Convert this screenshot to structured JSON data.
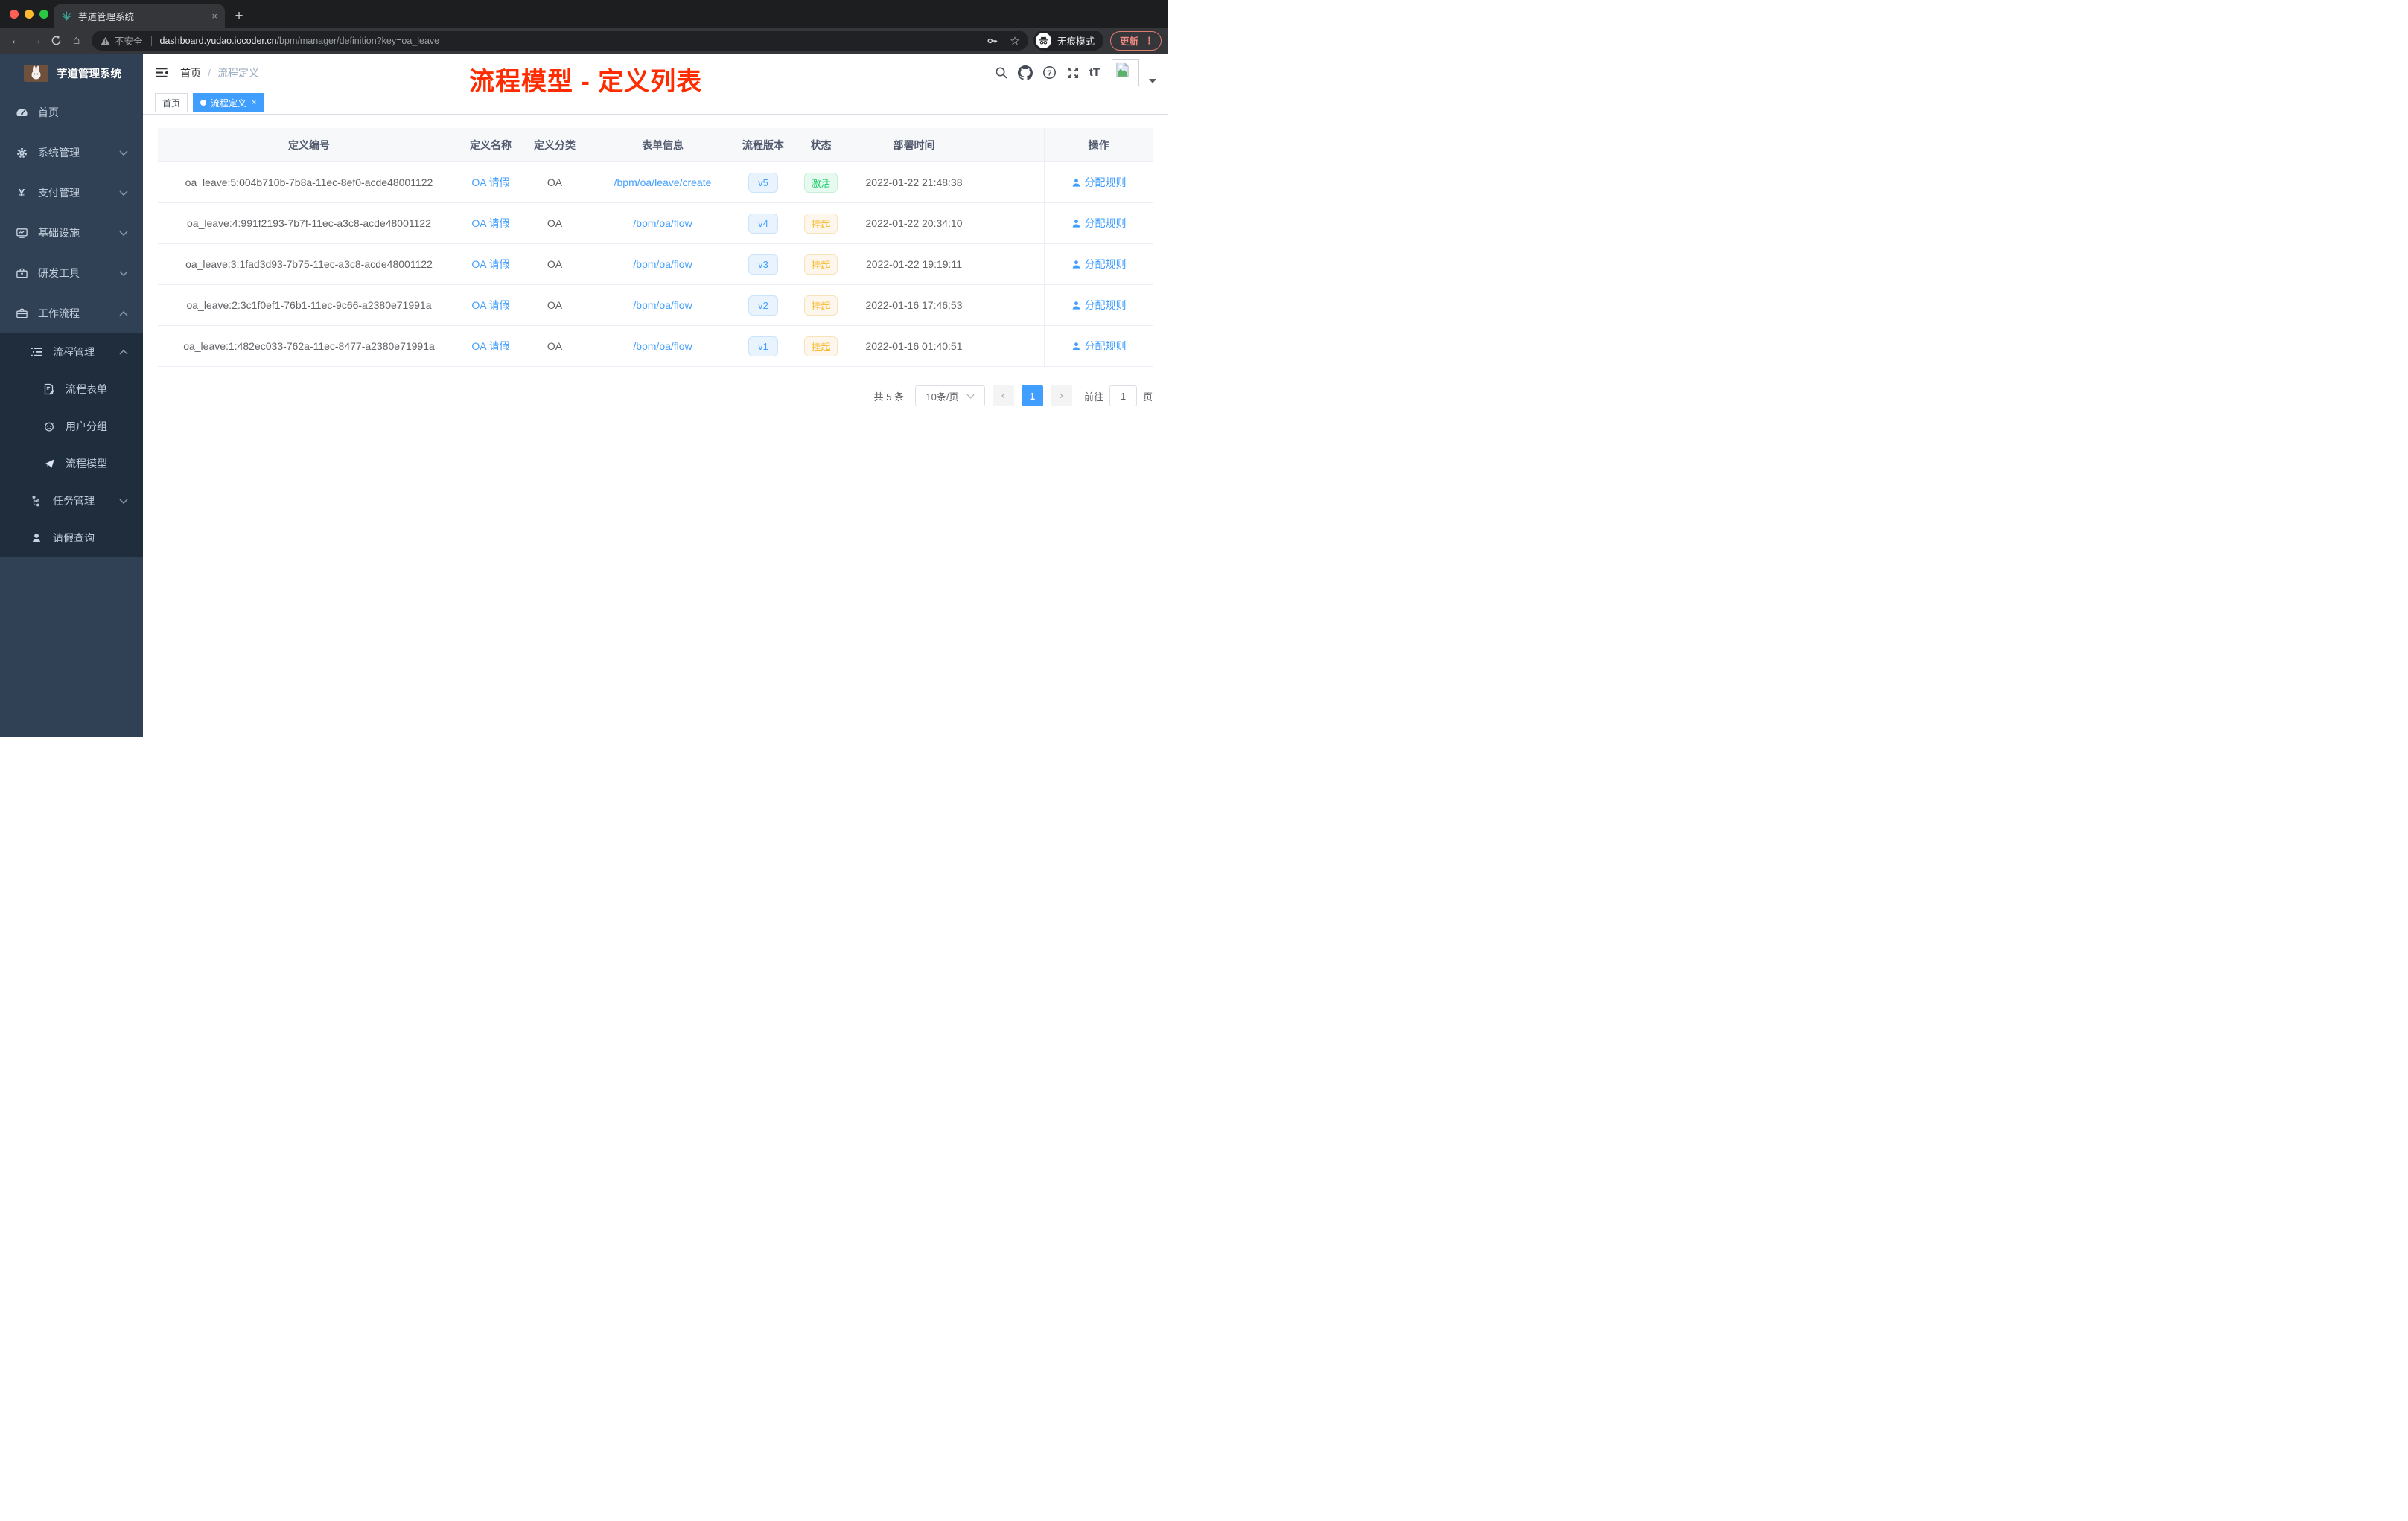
{
  "browser": {
    "tab": {
      "title": "芋道管理系统",
      "close_label": "×",
      "new_tab_label": "+"
    },
    "address": {
      "security_label": "不安全",
      "domain": "dashboard.yudao.iocoder.cn",
      "path": "/bpm/manager/definition?key=oa_leave"
    },
    "incognito_label": "无痕模式",
    "update_label": "更新",
    "menu_dots": "⋮"
  },
  "sidebar": {
    "logo_title": "芋道管理系统",
    "menu": [
      {
        "label": "首页"
      },
      {
        "label": "系统管理"
      },
      {
        "label": "支付管理"
      },
      {
        "label": "基础设施"
      },
      {
        "label": "研发工具"
      },
      {
        "label": "工作流程"
      }
    ],
    "workflow_submenu": {
      "parent": {
        "label": "流程管理"
      },
      "children": [
        {
          "label": "流程表单"
        },
        {
          "label": "用户分组"
        },
        {
          "label": "流程模型"
        }
      ],
      "siblings": [
        {
          "label": "任务管理"
        },
        {
          "label": "请假查询"
        }
      ]
    },
    "yen_glyph": "¥"
  },
  "header": {
    "breadcrumb": {
      "root": "首页",
      "separator": "/",
      "current": "流程定义"
    },
    "font_size_icon_label": "tT"
  },
  "annotation": {
    "text": "流程模型 - 定义列表",
    "color": "#fe2c00"
  },
  "tags": [
    {
      "label": "首页",
      "active": false
    },
    {
      "label": "流程定义",
      "active": true,
      "close_label": "×"
    }
  ],
  "table": {
    "columns": [
      "定义编号",
      "定义名称",
      "定义分类",
      "表单信息",
      "流程版本",
      "状态",
      "部署时间",
      "操作"
    ],
    "rows": [
      {
        "id": "oa_leave:5:004b710b-7b8a-11ec-8ef0-acde48001122",
        "name": "OA 请假",
        "category": "OA",
        "form": "/bpm/oa/leave/create",
        "version": "v5",
        "status": "激活",
        "deployed_at": "2022-01-22 21:48:38",
        "action": "分配规则"
      },
      {
        "id": "oa_leave:4:991f2193-7b7f-11ec-a3c8-acde48001122",
        "name": "OA 请假",
        "category": "OA",
        "form": "/bpm/oa/flow",
        "version": "v4",
        "status": "挂起",
        "deployed_at": "2022-01-22 20:34:10",
        "action": "分配规则"
      },
      {
        "id": "oa_leave:3:1fad3d93-7b75-11ec-a3c8-acde48001122",
        "name": "OA 请假",
        "category": "OA",
        "form": "/bpm/oa/flow",
        "version": "v3",
        "status": "挂起",
        "deployed_at": "2022-01-22 19:19:11",
        "action": "分配规则"
      },
      {
        "id": "oa_leave:2:3c1f0ef1-76b1-11ec-9c66-a2380e71991a",
        "name": "OA 请假",
        "category": "OA",
        "form": "/bpm/oa/flow",
        "version": "v2",
        "status": "挂起",
        "deployed_at": "2022-01-16 17:46:53",
        "action": "分配规则"
      },
      {
        "id": "oa_leave:1:482ec033-762a-11ec-8477-a2380e71991a",
        "name": "OA 请假",
        "category": "OA",
        "form": "/bpm/oa/flow",
        "version": "v1",
        "status": "挂起",
        "deployed_at": "2022-01-16 01:40:51",
        "action": "分配规则"
      }
    ]
  },
  "pagination": {
    "total": "共 5 条",
    "page_size": "10条/页",
    "prev": "‹",
    "current_page": "1",
    "next": "›",
    "goto_label": "前往",
    "goto_value": "1",
    "page_unit": "页"
  },
  "icons": {
    "star": "☆",
    "back_arrow": "←",
    "forward_arrow": "→",
    "home": "⌂"
  },
  "colors": {
    "accent": "#409eff",
    "sidebar_bg": "#304156",
    "submenu_bg": "#1f2d3d",
    "status_active_text": "#13ce66",
    "status_active_bg": "#e7faf0",
    "status_suspended_text": "#f7ba2a",
    "status_suspended_bg": "#fdf6ec",
    "version_text": "#409eff",
    "version_bg": "#e8f3fe",
    "annotation_red": "#fe2c00",
    "update_red": "#ee8a7f"
  }
}
